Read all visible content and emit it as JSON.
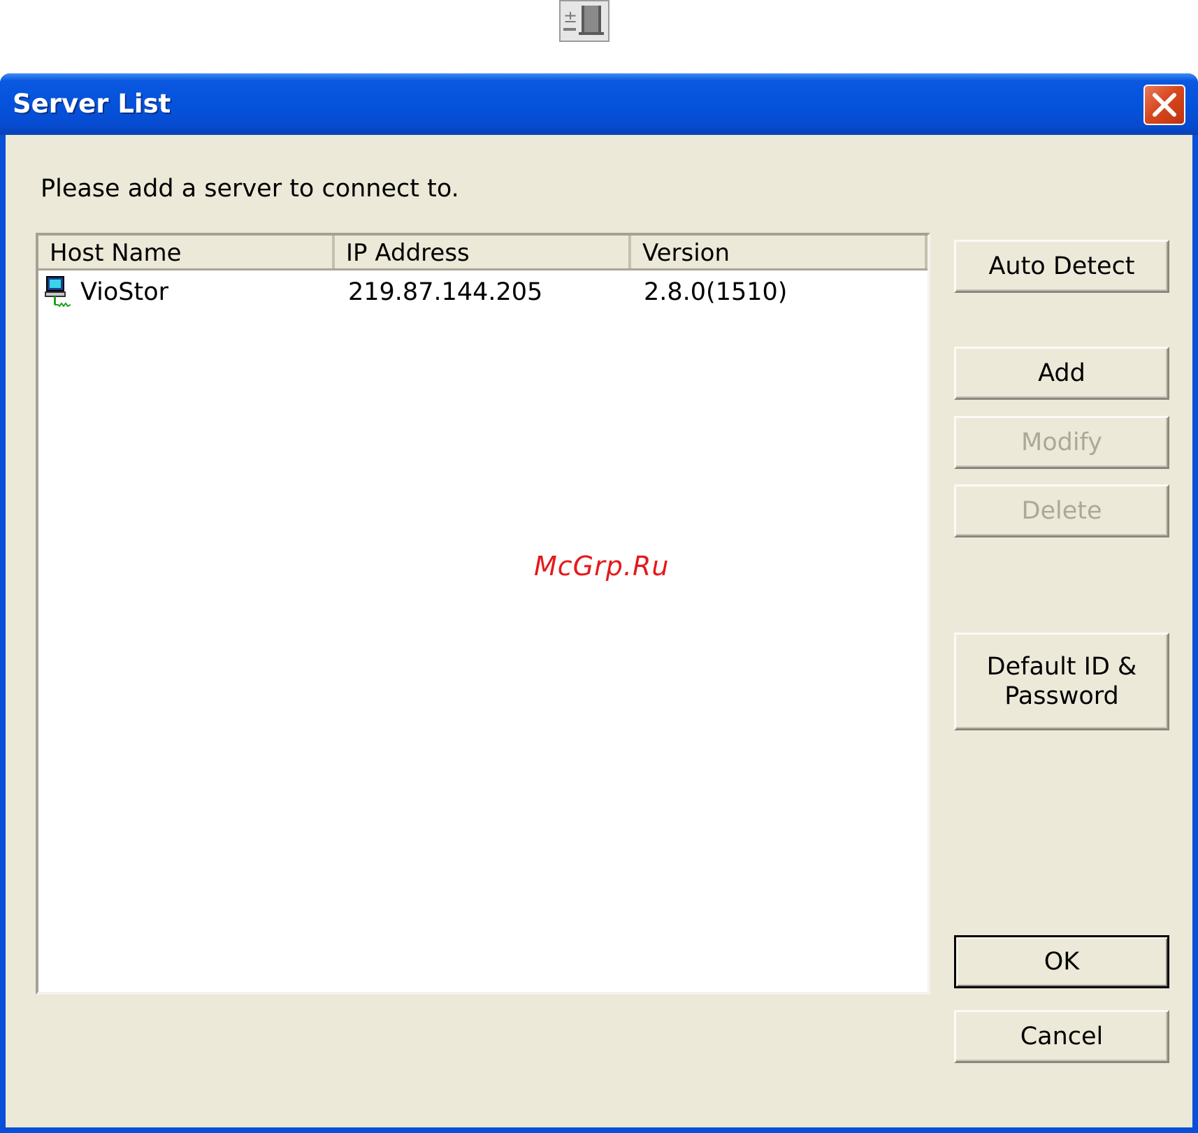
{
  "window": {
    "title": "Server List"
  },
  "dialog": {
    "prompt": "Please add a server to connect to."
  },
  "server_list": {
    "columns": [
      "Host Name",
      "IP Address",
      "Version"
    ],
    "rows": [
      {
        "host_name": "VioStor",
        "ip_address": "219.87.144.205",
        "version": "2.8.0(1510)",
        "icon": "server-computer-icon"
      }
    ]
  },
  "buttons": {
    "auto_detect": "Auto Detect",
    "add": "Add",
    "modify": "Modify",
    "delete": "Delete",
    "default_id_line1": "Default ID &",
    "default_id_line2": "Password",
    "ok": "OK",
    "cancel": "Cancel"
  },
  "button_states": {
    "modify": "disabled",
    "delete": "disabled",
    "ok": "default"
  },
  "watermark": "McGrp.Ru",
  "colors": {
    "titlebar": "#0553dc",
    "dialog_background": "#ece9d8",
    "close_button": "#d8481f",
    "disabled_text": "#aca899",
    "watermark": "#e5191b"
  }
}
